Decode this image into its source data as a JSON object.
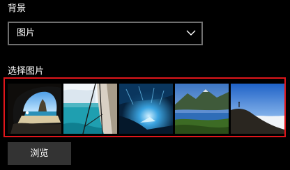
{
  "background": {
    "label": "背景",
    "dropdown": {
      "selected": "图片",
      "icon": "chevron-down-icon"
    }
  },
  "picture_picker": {
    "label": "选择图片",
    "highlight_color": "#e0161b",
    "thumbnails": [
      {
        "name": "cave-beach"
      },
      {
        "name": "coastal-cliff"
      },
      {
        "name": "ice-cave"
      },
      {
        "name": "mountain-lake"
      },
      {
        "name": "hill-sky"
      }
    ]
  },
  "browse_button": {
    "label": "浏览"
  }
}
